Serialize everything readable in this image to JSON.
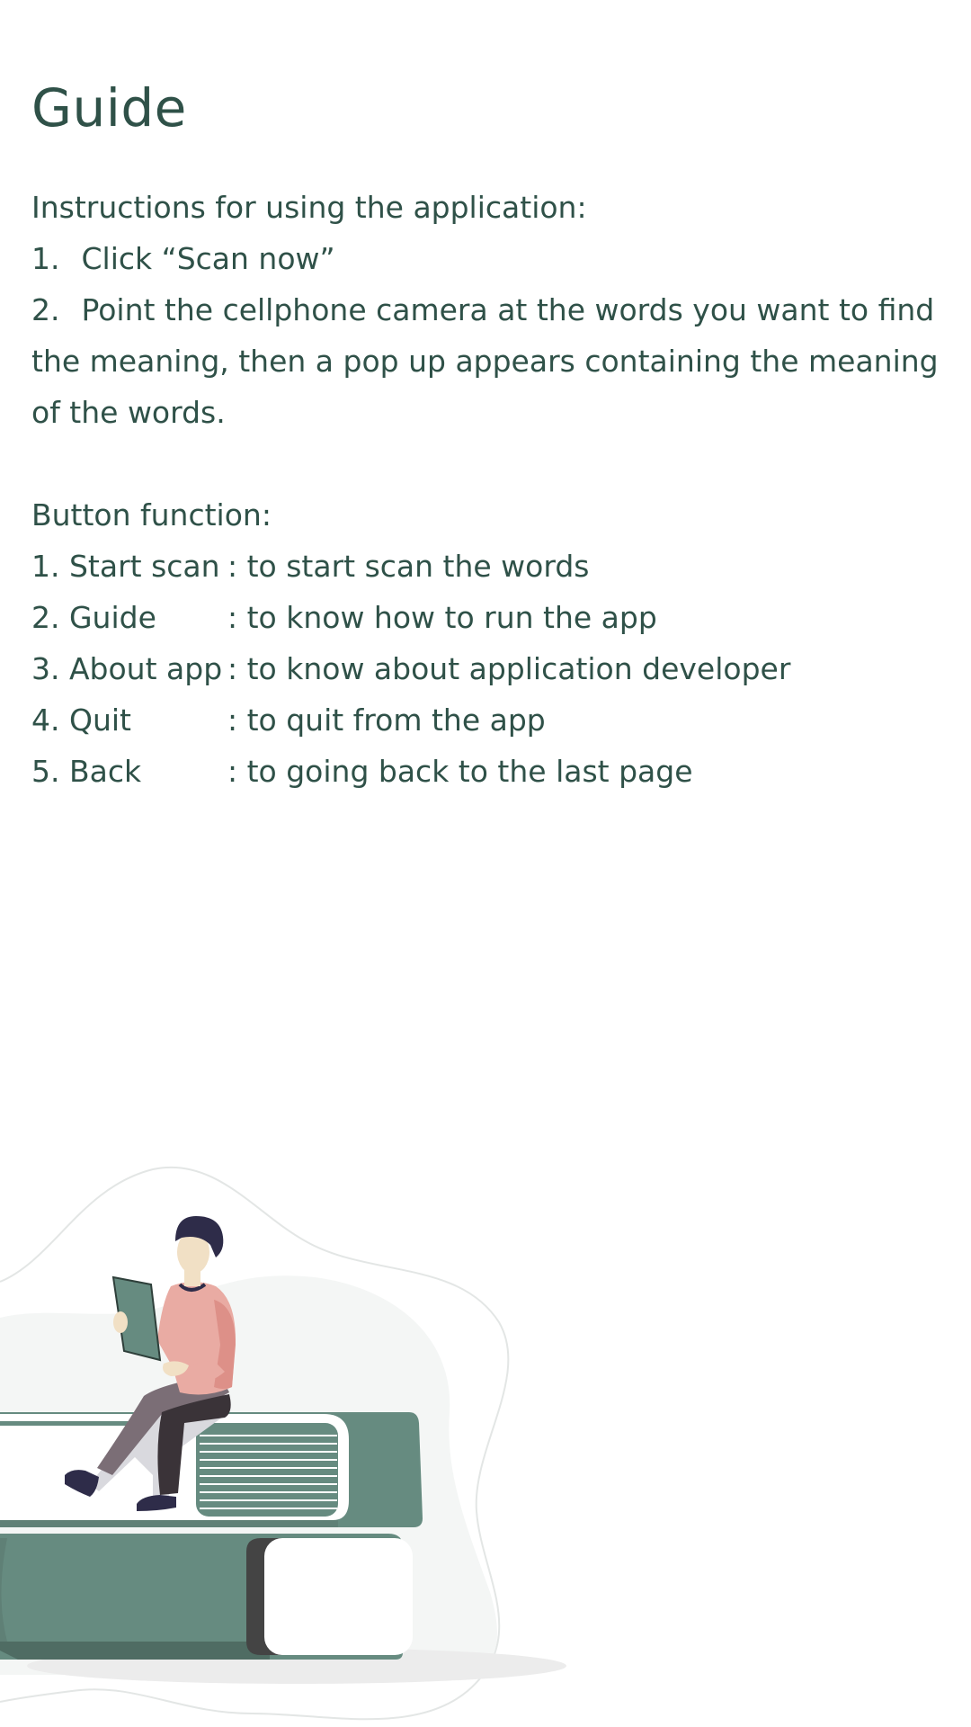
{
  "page": {
    "title": "Guide"
  },
  "instructions": {
    "heading": "Instructions for using the application:",
    "step1_num": "1.",
    "step1_text": "Click “Scan now”",
    "step2_num": "2.",
    "step2_line1": "Point the cellphone camera at the words you want to find",
    "step2_line2": "the meaning, then a pop up appears containing the meaning",
    "step2_line3": "of the words."
  },
  "button_function": {
    "heading": "Button function:",
    "items": [
      {
        "name": "1. Start scan",
        "desc": ": to start scan the words"
      },
      {
        "name": "2. Guide",
        "desc": ": to know how to run the app"
      },
      {
        "name": "3. About app",
        "desc": ": to know about application developer"
      },
      {
        "name": "4. Quit",
        "desc": ": to quit from the app"
      },
      {
        "name": "5. Back",
        "desc": ": to going back to the last page"
      }
    ]
  },
  "colors": {
    "text": "#2f5148",
    "book_green": "#668b80",
    "shirt_pink": "#e9aba3",
    "dark_navy": "#2e2c49"
  },
  "illustration": {
    "icon": "person-reading-on-books-illustration"
  }
}
